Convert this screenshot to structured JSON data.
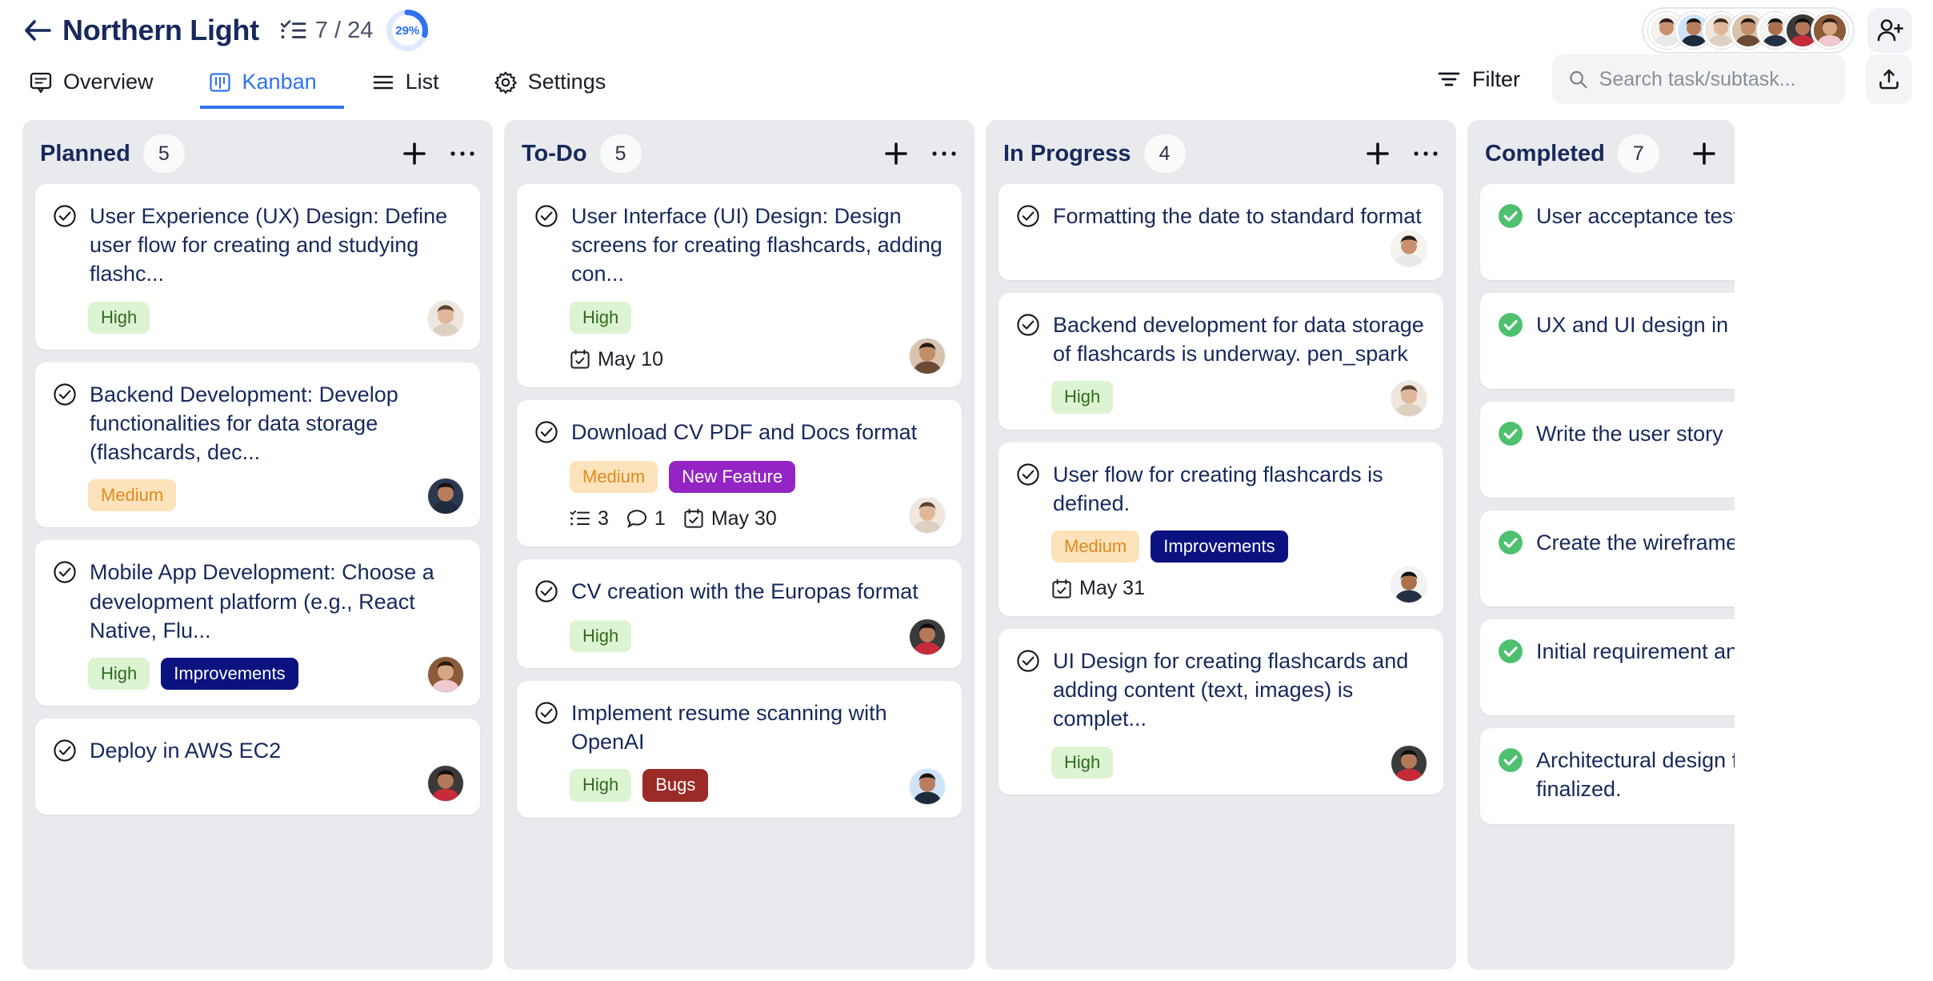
{
  "header": {
    "back_icon": "arrow-left-icon",
    "project_title": "Northern Light",
    "checklist_icon": "checklist-icon",
    "task_count": "7 / 24",
    "progress_percent": "29%",
    "progress_value": 29,
    "add_member_icon": "person-add-icon",
    "avatars": [
      {
        "skin": "#c99070",
        "hair": "#2c2018",
        "bg": "#f6f3ef",
        "cloth": "#e8e9ed"
      },
      {
        "skin": "#b87d5c",
        "hair": "#17120e",
        "bg": "#cfe3f7",
        "cloth": "#1d2a3c"
      },
      {
        "skin": "#e0b79a",
        "hair": "#3a2a1c",
        "bg": "#efe6de",
        "cloth": "#ded0c0"
      },
      {
        "skin": "#c18e68",
        "hair": "#231813",
        "bg": "#d9c3ae",
        "cloth": "#6b4a36"
      },
      {
        "skin": "#a9714c",
        "hair": "#14100c",
        "bg": "#f2f2f2",
        "cloth": "#233044"
      },
      {
        "skin": "#b4795a",
        "hair": "#120e0b",
        "bg": "#3a3a3a",
        "cloth": "#c62b3a"
      },
      {
        "skin": "#d6a784",
        "hair": "#2b1d14",
        "bg": "#8b5b3a",
        "cloth": "#f0c9cf"
      }
    ]
  },
  "tabs": [
    {
      "label": "Overview",
      "icon": "comment-box-icon",
      "active": false
    },
    {
      "label": "Kanban",
      "icon": "kanban-board-icon",
      "active": true
    },
    {
      "label": "List",
      "icon": "list-icon",
      "active": false
    },
    {
      "label": "Settings",
      "icon": "gear-icon",
      "active": false
    }
  ],
  "toolbar": {
    "filter_label": "Filter",
    "filter_icon": "filter-icon",
    "search_icon": "search-icon",
    "search_placeholder": "Search task/subtask...",
    "search_value": "",
    "export_icon": "export-upload-icon"
  },
  "colors": {
    "accent": "#2f72f0",
    "title": "#17295c",
    "column_bg": "#e9eaee",
    "priority_high_bg": "#ddf4d2",
    "priority_high_text": "#2f6b1d",
    "priority_medium_bg": "#fde3bb",
    "priority_medium_text": "#e08a1e",
    "tag_new_feature": "#9425c4",
    "tag_improvements": "#0b1280",
    "tag_bugs": "#9b2b26",
    "completed_check": "#4ec06e"
  },
  "columns": [
    {
      "name": "Planned",
      "count": "5",
      "add_icon": "plus-icon",
      "more_icon": "more-horizontal-icon",
      "cards": [
        {
          "title": "User Experience (UX) Design: Define user flow for creating and studying flashc...",
          "priority": "High",
          "tag": null,
          "subtasks": null,
          "comments": null,
          "date": null,
          "avatar": {
            "skin": "#e0b79a",
            "hair": "#5a4430",
            "bg": "#efe6de",
            "cloth": "#ded0c0"
          }
        },
        {
          "title": "Backend Development: Develop functionalities for data storage (flashcards, dec...",
          "priority": "Medium",
          "tag": null,
          "subtasks": null,
          "comments": null,
          "date": null,
          "avatar": {
            "skin": "#b87d5c",
            "hair": "#17120e",
            "bg": "#2b3850",
            "cloth": "#1d2a3c"
          }
        },
        {
          "title": "Mobile App Development: Choose a development platform (e.g., React Native, Flu...",
          "priority": "High",
          "tag": {
            "label": "Improvements",
            "color": "#0b1280"
          },
          "subtasks": null,
          "comments": null,
          "date": null,
          "avatar": {
            "skin": "#d6a784",
            "hair": "#2b1d14",
            "bg": "#8b5b3a",
            "cloth": "#f0c9cf"
          }
        },
        {
          "title": "Deploy in AWS EC2",
          "priority": null,
          "tag": null,
          "subtasks": null,
          "comments": null,
          "date": null,
          "avatar": {
            "skin": "#b4795a",
            "hair": "#120e0b",
            "bg": "#3a3a3a",
            "cloth": "#c62b3a"
          }
        }
      ]
    },
    {
      "name": "To-Do",
      "count": "5",
      "add_icon": "plus-icon",
      "more_icon": "more-horizontal-icon",
      "cards": [
        {
          "title": "User Interface (UI) Design: Design screens for creating flashcards, adding con...",
          "priority": "High",
          "tag": null,
          "subtasks": null,
          "comments": null,
          "date": "May 10",
          "avatar": {
            "skin": "#c18e68",
            "hair": "#231813",
            "bg": "#d9c3ae",
            "cloth": "#6b4a36"
          }
        },
        {
          "title": "Download CV PDF and Docs format",
          "priority": "Medium",
          "tag": {
            "label": "New Feature",
            "color": "#9425c4"
          },
          "subtasks": "3",
          "comments": "1",
          "date": "May 30",
          "avatar": {
            "skin": "#e0b79a",
            "hair": "#5a4430",
            "bg": "#efe6de",
            "cloth": "#ded0c0"
          }
        },
        {
          "title": "CV creation with the Europas format",
          "priority": "High",
          "tag": null,
          "subtasks": null,
          "comments": null,
          "date": null,
          "avatar": {
            "skin": "#b4795a",
            "hair": "#120e0b",
            "bg": "#3a3a3a",
            "cloth": "#c62b3a"
          }
        },
        {
          "title": "Implement resume scanning with OpenAI",
          "priority": "High",
          "tag": {
            "label": "Bugs",
            "color": "#9b2b26"
          },
          "subtasks": null,
          "comments": null,
          "date": null,
          "avatar": {
            "skin": "#b87d5c",
            "hair": "#17120e",
            "bg": "#cfe3f7",
            "cloth": "#1d2a3c"
          }
        }
      ]
    },
    {
      "name": "In Progress",
      "count": "4",
      "add_icon": "plus-icon",
      "more_icon": "more-horizontal-icon",
      "cards": [
        {
          "title": "Formatting the date to standard format",
          "priority": null,
          "tag": null,
          "subtasks": null,
          "comments": null,
          "date": null,
          "avatar": {
            "skin": "#c99070",
            "hair": "#2c2018",
            "bg": "#f6f3ef",
            "cloth": "#e8e9ed"
          }
        },
        {
          "title": "Backend development for data storage of flashcards is underway. pen_spark",
          "priority": "High",
          "tag": null,
          "subtasks": null,
          "comments": null,
          "date": null,
          "avatar": {
            "skin": "#e0b79a",
            "hair": "#5a4430",
            "bg": "#efe6de",
            "cloth": "#ded0c0"
          }
        },
        {
          "title": "User flow for creating flashcards is defined.",
          "priority": "Medium",
          "tag": {
            "label": "Improvements",
            "color": "#0b1280"
          },
          "subtasks": null,
          "comments": null,
          "date": "May 31",
          "avatar": {
            "skin": "#a9714c",
            "hair": "#14100c",
            "bg": "#f2f2f2",
            "cloth": "#233044"
          }
        },
        {
          "title": "UI Design for creating flashcards and adding content (text, images) is complet...",
          "priority": "High",
          "tag": null,
          "subtasks": null,
          "comments": null,
          "date": null,
          "avatar": {
            "skin": "#b4795a",
            "hair": "#120e0b",
            "bg": "#3a3a3a",
            "cloth": "#c62b3a"
          }
        }
      ]
    },
    {
      "name": "Completed",
      "count": "7",
      "add_icon": "plus-icon",
      "more_icon": null,
      "completed": true,
      "cards": [
        {
          "title": "User acceptance testing",
          "priority": null,
          "tag": null,
          "date": null,
          "avatar": null
        },
        {
          "title": "UX and UI design in Figma",
          "priority": null,
          "tag": null,
          "date": null,
          "avatar": null
        },
        {
          "title": "Write the user story",
          "priority": null,
          "tag": null,
          "date": null,
          "avatar": {
            "skin": "#d6a784",
            "hair": "#2b1d14",
            "bg": "#8b5b3a",
            "cloth": "#f0c9cf"
          }
        },
        {
          "title": "Create the wireframe",
          "priority": null,
          "tag": null,
          "date": null,
          "avatar": {
            "skin": "#c18e68",
            "hair": "#231813",
            "bg": "#d9c3ae",
            "cloth": "#6b4a36"
          }
        },
        {
          "title": "Initial requirement analysis",
          "priority": null,
          "tag": null,
          "date": null,
          "avatar": {
            "skin": "#b4795a",
            "hair": "#120e0b",
            "bg": "#3a3a3a",
            "cloth": "#c62b3a"
          }
        },
        {
          "title": "Architectural design for the application is finalized.",
          "priority": null,
          "tag": null,
          "date": null,
          "avatar": null
        }
      ]
    }
  ]
}
